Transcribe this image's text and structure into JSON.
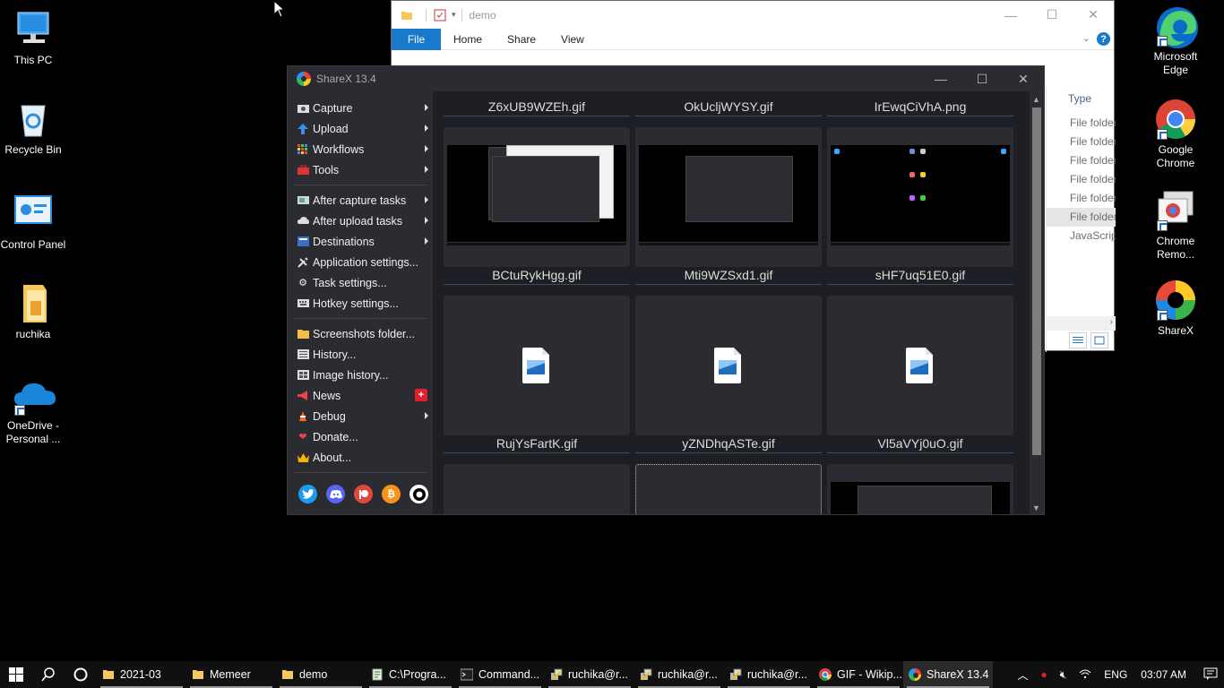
{
  "desktop": {
    "left_icons": [
      {
        "label": "This PC"
      },
      {
        "label": "Recycle Bin"
      },
      {
        "label": "Control Panel"
      },
      {
        "label": "ruchika"
      },
      {
        "label": "OneDrive - Personal ..."
      }
    ],
    "right_icons": [
      {
        "label": "Microsoft Edge"
      },
      {
        "label": "Google Chrome"
      },
      {
        "label": "Chrome Remo..."
      },
      {
        "label": "ShareX"
      }
    ]
  },
  "explorer": {
    "title": "demo",
    "ribbon_tabs": [
      "File",
      "Home",
      "Share",
      "View"
    ],
    "column_header": "Type",
    "rows": [
      "File folder",
      "File folder",
      "File folder",
      "File folder",
      "File folder",
      "File folder",
      "JavaScript"
    ]
  },
  "sharex": {
    "title": "ShareX 13.4",
    "menu": {
      "capture": "Capture",
      "upload": "Upload",
      "workflows": "Workflows",
      "tools": "Tools",
      "after_capture": "After capture tasks",
      "after_upload": "After upload tasks",
      "destinations": "Destinations",
      "app_settings": "Application settings...",
      "task_settings": "Task settings...",
      "hotkey_settings": "Hotkey settings...",
      "screenshots_folder": "Screenshots folder...",
      "history": "History...",
      "image_history": "Image history...",
      "news": "News",
      "news_badge": "+",
      "debug": "Debug",
      "donate": "Donate...",
      "about": "About..."
    },
    "files": [
      "Z6xUB9WZEh.gif",
      "OkUcljWYSY.gif",
      "IrEwqCiVhA.png",
      "BCtuRykHgg.gif",
      "Mti9WZSxd1.gif",
      "sHF7uq51E0.gif",
      "RujYsFartK.gif",
      "yZNDhqASTe.gif",
      "Vl5aVYj0uO.gif"
    ]
  },
  "taskbar": {
    "items": [
      "2021-03",
      "Memeer",
      "demo",
      "C:\\Progra...",
      "Command...",
      "ruchika@r...",
      "ruchika@r...",
      "ruchika@r...",
      "GIF - Wikip...",
      "ShareX 13.4"
    ],
    "lang": "ENG",
    "time": "03:07 AM"
  },
  "colors": {
    "sharex_bg": "#1e1f24",
    "sharex_panel": "#2b2c31",
    "explorer_accent": "#1979ca",
    "taskbar": "#101010"
  }
}
